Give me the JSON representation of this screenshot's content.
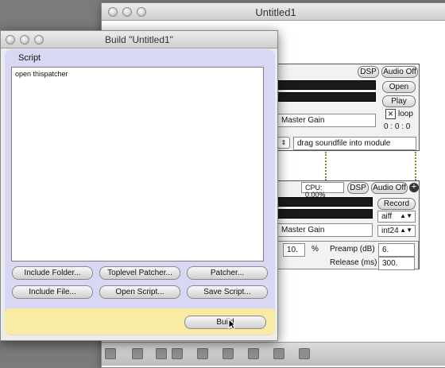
{
  "back_window": {
    "title": "Untitled1",
    "player": {
      "dsp": "DSP",
      "audio_off": "Audio Off",
      "open": "Open",
      "play": "Play",
      "loop": "loop",
      "time": "0 : 0 : 0",
      "gain": "Master Gain",
      "drag_hint": "drag soundfile into module"
    },
    "recorder": {
      "cpu": "CPU: 0.00%",
      "dsp": "DSP",
      "audio_off": "Audio Off",
      "record": "Record",
      "format": "aiff",
      "bitdepth": "int24",
      "gain": "Master Gain",
      "ratio_value": "10.",
      "percent": "%",
      "preamp_label": "Preamp (dB)",
      "preamp_value": "6.",
      "release_label": "Release (ms)",
      "release_value": "300."
    }
  },
  "dialog": {
    "title": "Build \"Untitled1\"",
    "script_label": "Script",
    "script_text": "open thispatcher",
    "buttons": {
      "include_folder": "Include Folder...",
      "toplevel_patcher": "Toplevel Patcher...",
      "patcher": "Patcher...",
      "include_file": "Include File...",
      "open_script": "Open Script...",
      "save_script": "Save Script...",
      "build": "Build"
    }
  },
  "colors": {
    "script_panel": "#d8d8f4",
    "build_panel": "#faeba4"
  }
}
